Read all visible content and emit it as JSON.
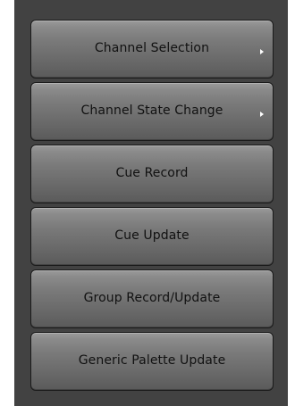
{
  "menu": {
    "items": [
      {
        "label": "Channel Selection",
        "submenu_icon": "chevron-right-icon"
      },
      {
        "label": "Channel State Change",
        "submenu_icon": "chevron-right-icon"
      },
      {
        "label": "Cue Record"
      },
      {
        "label": "Cue Update"
      },
      {
        "label": "Group Record/Update"
      },
      {
        "label": "Generic Palette Update"
      }
    ]
  },
  "colors": {
    "panel_background": "#424242",
    "button_gradient_top": "#9a9a9a",
    "button_gradient_bottom": "#5a5a5a",
    "label_text": "#111111",
    "arrow": "#ffffff"
  }
}
